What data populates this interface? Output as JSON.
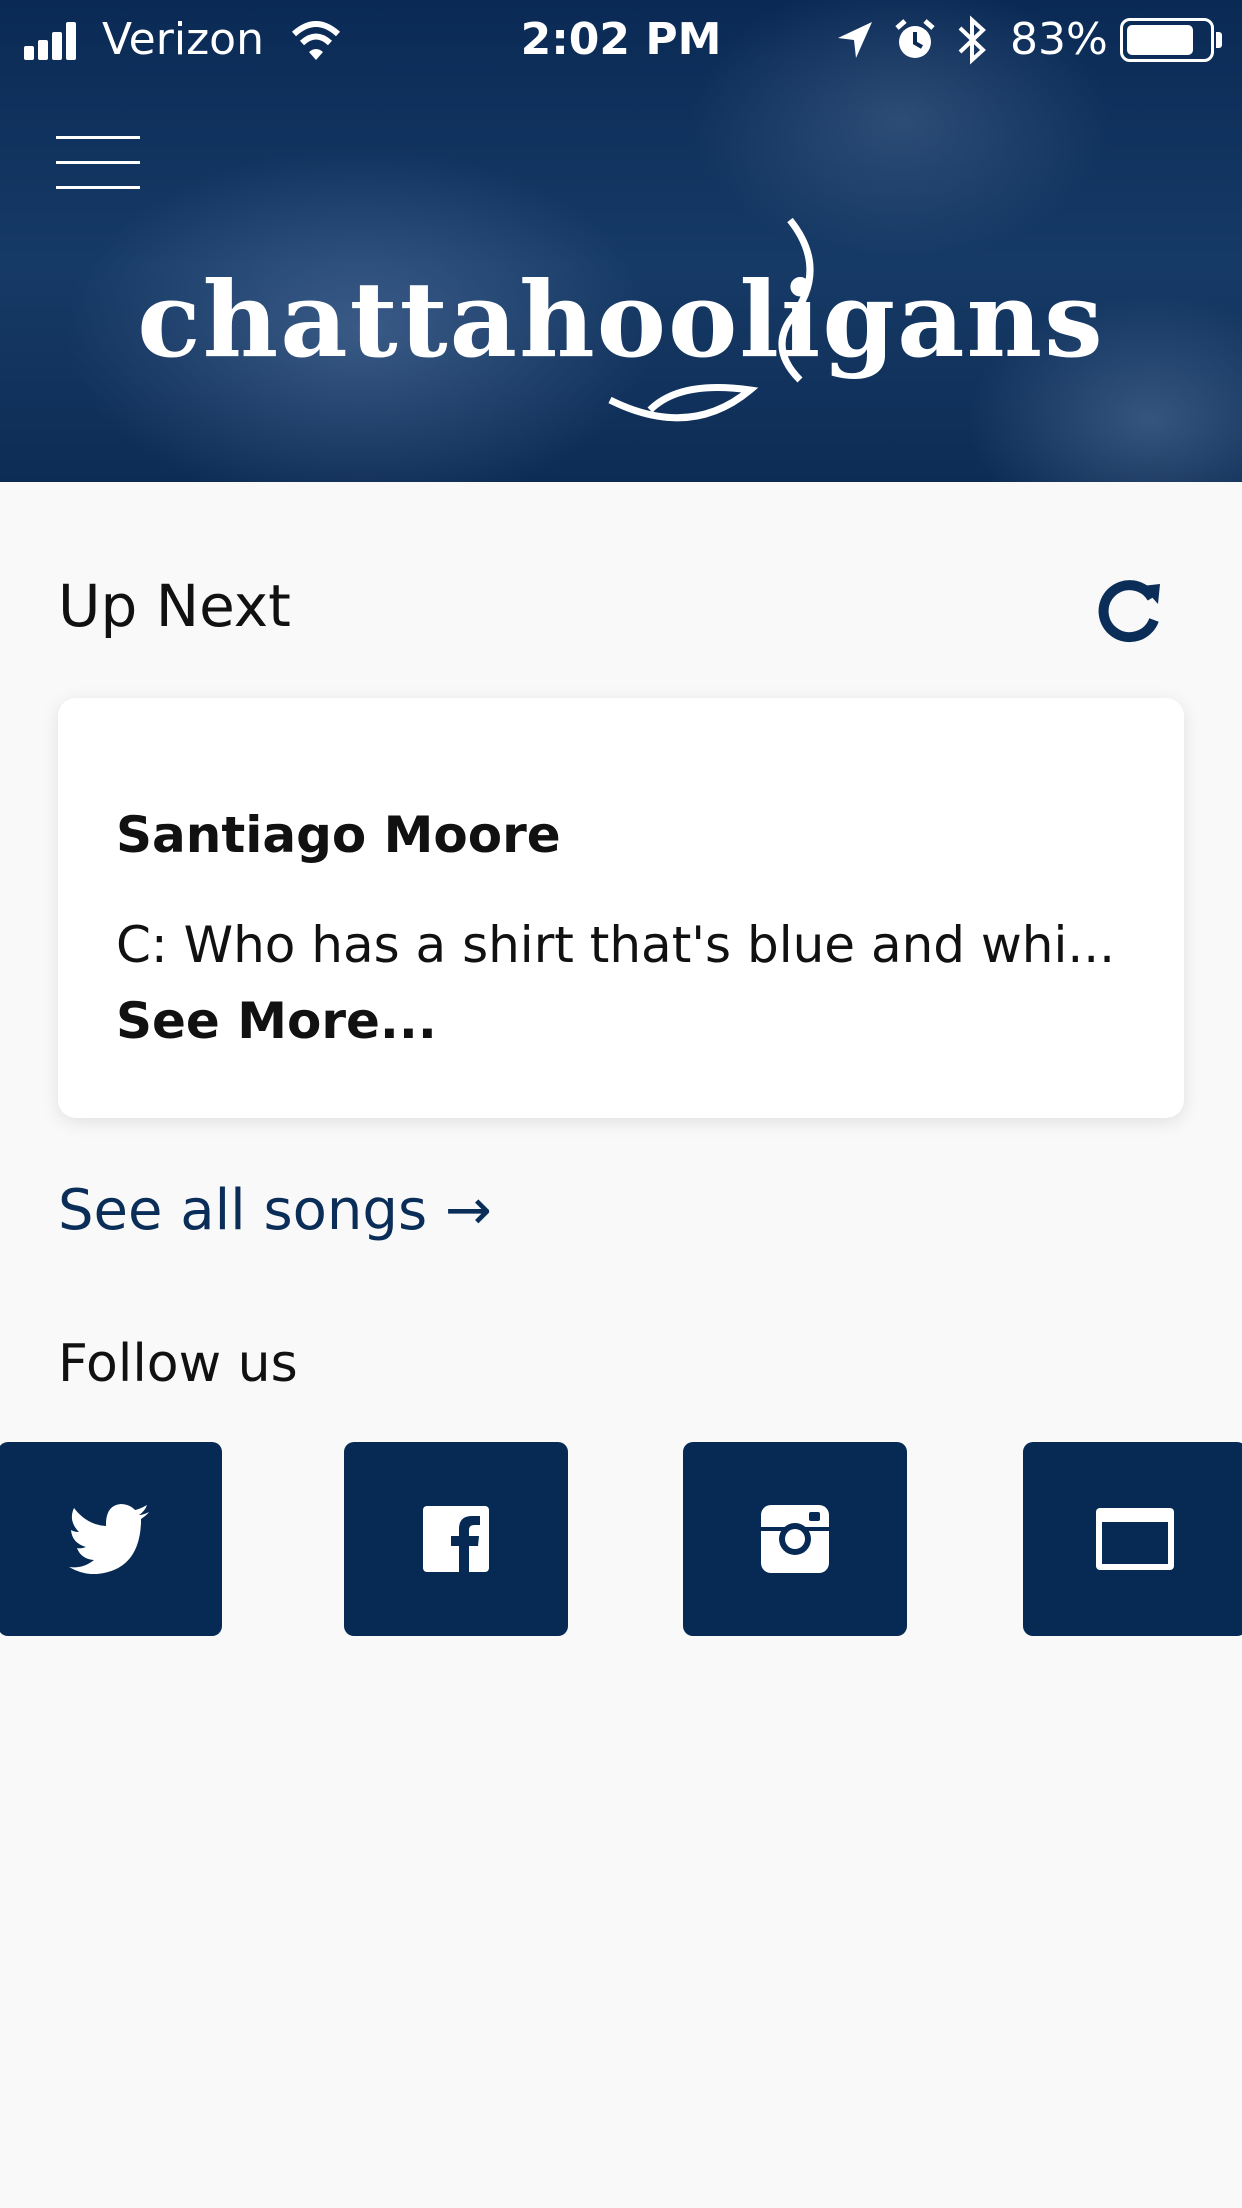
{
  "status_bar": {
    "carrier": "Verizon",
    "time": "2:02 PM",
    "battery_percent": "83%",
    "battery_level": 0.83,
    "icons": [
      "signal-icon",
      "wifi-icon",
      "location-arrow-icon",
      "alarm-icon",
      "bluetooth-icon",
      "battery-icon"
    ]
  },
  "header": {
    "logo_text": "chattahooligans",
    "menu_icon": "hamburger-menu-icon"
  },
  "up_next": {
    "title": "Up Next",
    "refresh_icon": "refresh-icon",
    "card": {
      "song_title": "Santiago Moore",
      "lyric_preview": "C: Who has a shirt that's blue and whi...",
      "see_more": "See More..."
    }
  },
  "see_all_songs": "See all songs →",
  "follow": {
    "title": "Follow us",
    "links": [
      {
        "icon": "twitter-icon"
      },
      {
        "icon": "facebook-icon"
      },
      {
        "icon": "instagram-icon"
      },
      {
        "icon": "website-icon"
      }
    ]
  },
  "colors": {
    "brand_navy": "#062a54",
    "link_navy": "#0b2e58",
    "background": "#f9f9f9"
  }
}
